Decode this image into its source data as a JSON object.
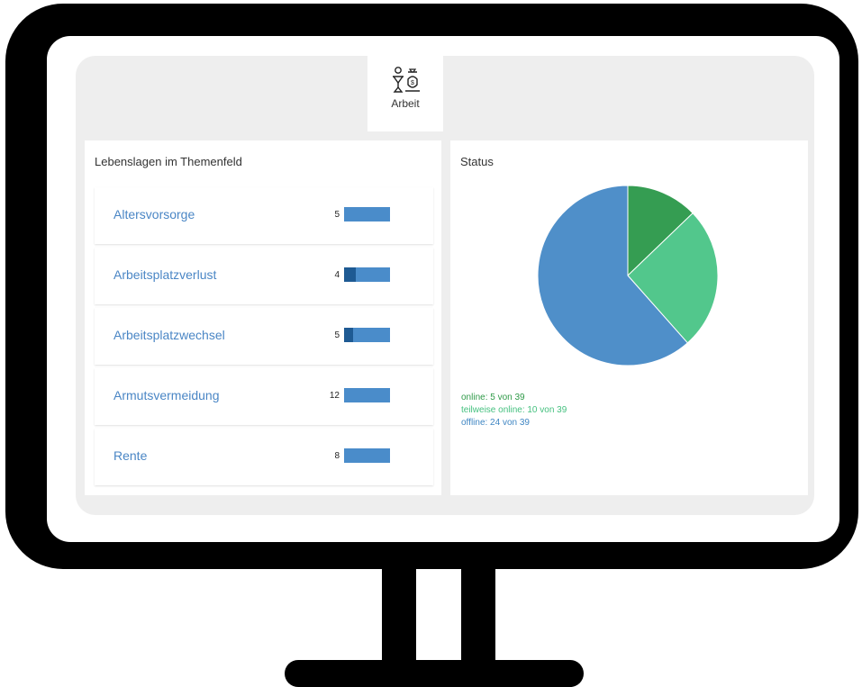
{
  "tab": {
    "label": "Arbeit",
    "icon": "balance-scale-icon"
  },
  "left_panel": {
    "title": "Lebenslagen im Themenfeld",
    "items": [
      {
        "label": "Altersvorsorge",
        "count": "5",
        "dark_fraction": 0
      },
      {
        "label": "Arbeitsplatzverlust",
        "count": "4",
        "dark_fraction": 0.25
      },
      {
        "label": "Arbeitsplatzwechsel",
        "count": "5",
        "dark_fraction": 0.2
      },
      {
        "label": "Armutsvermeidung",
        "count": "12",
        "dark_fraction": 0
      },
      {
        "label": "Rente",
        "count": "8",
        "dark_fraction": 0
      }
    ],
    "bar_colors": {
      "light": "#4a8cca",
      "dark": "#1e5a93"
    }
  },
  "right_panel": {
    "title": "Status",
    "legend": [
      {
        "text": "online: 5 von 39",
        "color": "#2f9a48"
      },
      {
        "text": "teilweise online: 10 von 39",
        "color": "#45c07f"
      },
      {
        "text": "offline: 24 von 39",
        "color": "#3f86c3"
      }
    ]
  },
  "chart_data": {
    "type": "pie",
    "title": "Status",
    "categories": [
      "online",
      "teilweise online",
      "offline"
    ],
    "values": [
      5,
      10,
      24
    ],
    "colors": [
      "#359d52",
      "#52c78c",
      "#4f8fc9"
    ]
  }
}
